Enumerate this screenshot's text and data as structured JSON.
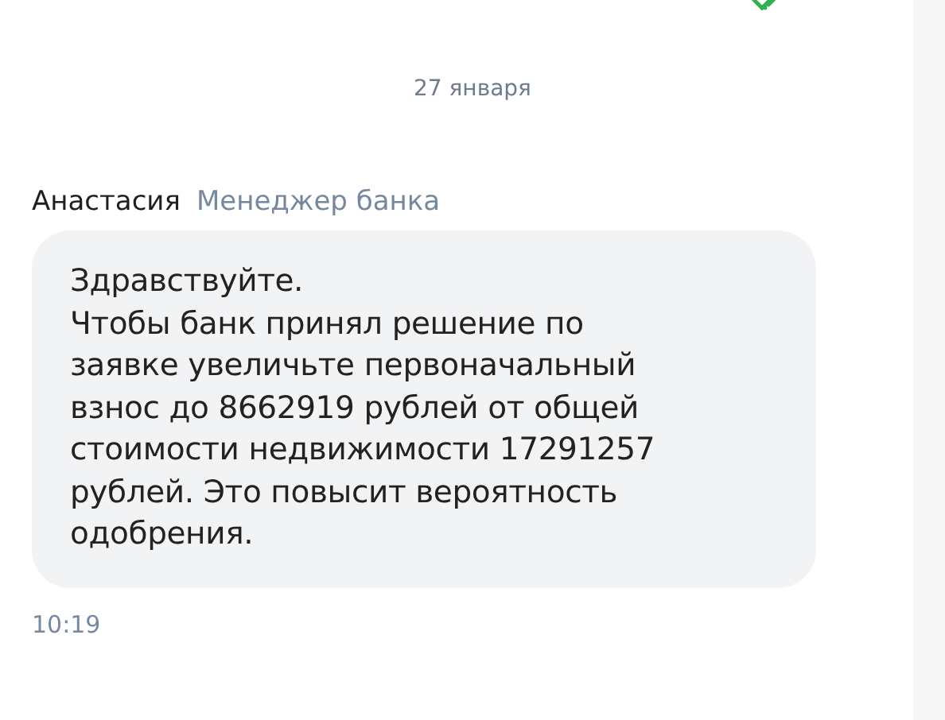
{
  "previous_message": {
    "delivered": true
  },
  "date_separator": "27 января",
  "message": {
    "author": "Анастасия",
    "role": "Менеджер банка",
    "text": "Здравствуйте.\nЧтобы банк принял решение по\nзаявке увеличьте первоначальный\nвзнос до 8662919 рублей от общей\nстоимости недвижимости 17291257\nрублей. Это повысит вероятность\nодобрения.",
    "time": "10:19"
  }
}
